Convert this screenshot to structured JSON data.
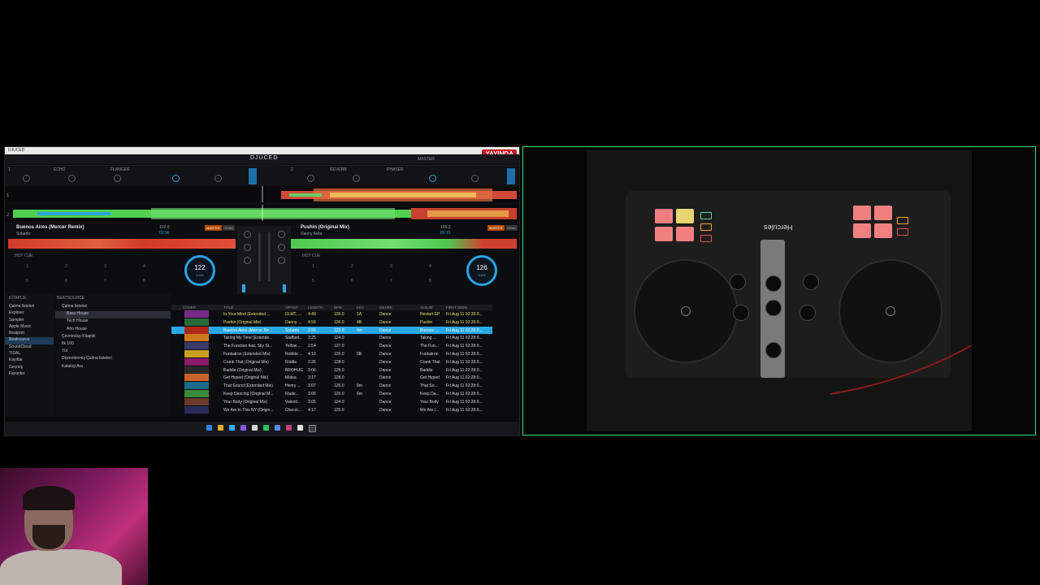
{
  "app": {
    "window_title": "DJUCED",
    "brand": "DJUCED",
    "live_badge": "YAYINDA",
    "master_label": "MASTER",
    "deck1": {
      "title": "Buenos Aires (Mercer Remix)",
      "artist": "Solardo",
      "bpm": "122.0",
      "time": "02:56",
      "jog_bpm": "122",
      "jog_pitch": "0.0%",
      "sync": "SYNC",
      "master": "MASTER"
    },
    "deck2": {
      "title": "Pushin (Original Mix)",
      "artist": "Danny Avila",
      "bpm": "126.0",
      "time": "02:15",
      "jog_bpm": "126",
      "jog_pitch": "0.0%",
      "sync": "SYNC",
      "master": "MASTER"
    },
    "fx_labels": [
      "ECHO",
      "FLANGER",
      "REVERB",
      "PHASER"
    ],
    "pad_numbers": [
      "1",
      "2",
      "3",
      "4",
      "5",
      "6",
      "7",
      "8"
    ],
    "hotcue": "HOT CUE"
  },
  "library": {
    "header": "KİTAPLIK",
    "items": [
      "Çalma listeleri",
      "Explorer",
      "Sampler",
      "Apple Music",
      "Beatport",
      "Beatsource",
      "SoundCloud",
      "TIDAL",
      "Kayıtlar",
      "Geçmiş",
      "Favoriler"
    ],
    "selected": 5
  },
  "tree": {
    "header": "BEATSOURCE",
    "items": [
      "Çalma listeleri",
      "Bass House",
      "Tech House",
      "Afro House",
      "Çevrimdışı Kitaplık",
      "Ilk 100",
      "Tür",
      "Düzenlenmiş Çalma listeleri",
      "Katalog Ara"
    ],
    "selected": 1
  },
  "table": {
    "headers": [
      "COVER",
      "TITLE",
      "ARTIST",
      "LENGTH",
      "BPM",
      "KEY",
      "GENRE",
      "ALBUM",
      "FIRST SEEN"
    ],
    "rows": [
      {
        "title": "In Your Mind (Extended ...",
        "artist": "DLMT, ...",
        "length": "4:49",
        "bpm": "126.0",
        "key": "1A",
        "genre": "Dance",
        "album": "Restart EP",
        "seen": "Fri Aug 11 02:28:0...",
        "state": "played"
      },
      {
        "title": "Pushin (Original Mix)",
        "artist": "Danny ...",
        "length": "4:56",
        "bpm": "126.0",
        "key": "4B",
        "genre": "Dance",
        "album": "Pushin",
        "seen": "Fri Aug 11 02:28:0...",
        "state": "played"
      },
      {
        "title": "Buenos Aires (Mercer Re...",
        "artist": "Solardo",
        "length": "2:56",
        "bpm": "122.0",
        "key": "4m",
        "genre": "Dance",
        "album": "Buenos ...",
        "seen": "Fri Aug 11 02:28:0...",
        "state": "selected"
      },
      {
        "title": "Taking My Time (Extende...",
        "artist": "Stafford...",
        "length": "3:25",
        "bpm": "124.0",
        "key": "",
        "genre": "Dance",
        "album": "Taking ...",
        "seen": "Fri Aug 11 02:28:0...",
        "state": ""
      },
      {
        "title": "The Function feat. Sky St...",
        "artist": "Yellow ...",
        "length": "2:54",
        "bpm": "127.0",
        "key": "",
        "genre": "Dance",
        "album": "The Fun...",
        "seen": "Fri Aug 11 02:28:0...",
        "state": ""
      },
      {
        "title": "Funkatron (Extended Mix)",
        "artist": "Robbie ...",
        "length": "4:19",
        "bpm": "126.0",
        "key": "9B",
        "genre": "Dance",
        "album": "Funkatron",
        "seen": "Fri Aug 11 02:28:0...",
        "state": ""
      },
      {
        "title": "Crank That (Original Mix)",
        "artist": "Riddle",
        "length": "2:26",
        "bpm": "128.0",
        "key": "",
        "genre": "Dance",
        "album": "Crank That",
        "seen": "Fri Aug 11 02:28:0...",
        "state": ""
      },
      {
        "title": "Baddie (Original Mix)",
        "artist": "BROHUG",
        "length": "3:06",
        "bpm": "125.0",
        "key": "",
        "genre": "Dance",
        "album": "Baddie",
        "seen": "Fri Aug 11 02:28:0...",
        "state": ""
      },
      {
        "title": "Get Hyped (Original Mix)",
        "artist": "Malaa",
        "length": "3:17",
        "bpm": "128.0",
        "key": "",
        "genre": "Dance",
        "album": "Get Hyped",
        "seen": "Fri Aug 11 02:28:0...",
        "state": ""
      },
      {
        "title": "That Sound (Extended Mix)",
        "artist": "Henry ...",
        "length": "3:07",
        "bpm": "126.0",
        "key": "9m",
        "genre": "Dance",
        "album": "That So...",
        "seen": "Fri Aug 11 02:28:0...",
        "state": ""
      },
      {
        "title": "Keep Dancing (Original M...",
        "artist": "Klude...",
        "length": "3:06",
        "bpm": "125.0",
        "key": "6m",
        "genre": "Dance",
        "album": "Keep Da...",
        "seen": "Fri Aug 11 02:28:0...",
        "state": ""
      },
      {
        "title": "Your Body (Original Mix)",
        "artist": "Valenti...",
        "length": "3:05",
        "bpm": "124.0",
        "key": "",
        "genre": "Dance",
        "album": "Your Body",
        "seen": "Fri Aug 11 02:28:0...",
        "state": ""
      },
      {
        "title": "We Are In This NY (Origin...",
        "artist": "Chocol...",
        "length": "4:17",
        "bpm": "125.0",
        "key": "",
        "genre": "Dance",
        "album": "We Are I...",
        "seen": "Fri Aug 11 02:28:0...",
        "state": ""
      }
    ]
  },
  "controller": {
    "brand": "Hercules"
  },
  "colors": {
    "accent": "#29a8e6",
    "live": "#c3151c",
    "cam_border": "#2fe08a"
  }
}
